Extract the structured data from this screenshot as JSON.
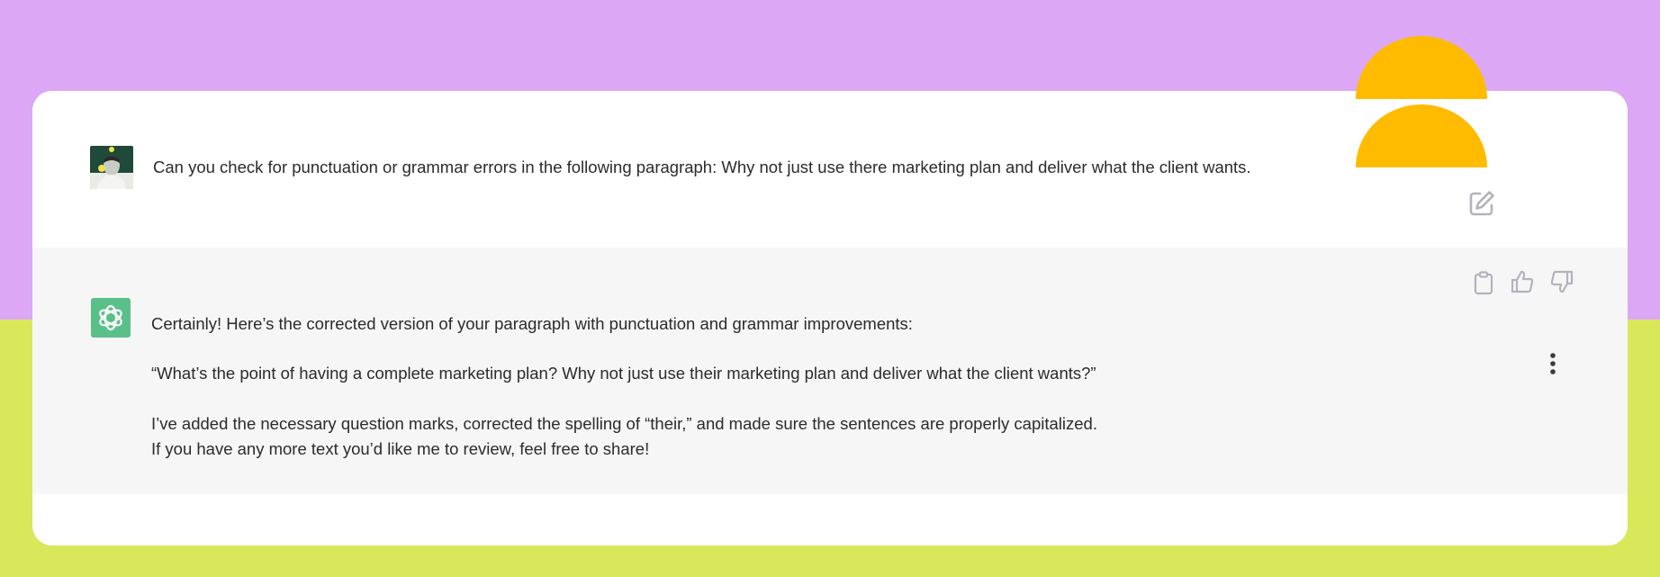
{
  "colors": {
    "background_top": "#dca8f5",
    "background_bottom": "#d9e85a",
    "card": "#ffffff",
    "assistant_row": "#f6f6f6",
    "bot_avatar": "#5ac08a",
    "accent_shape": "#ffbb00",
    "icon_gray": "#b3b3bd",
    "text": "#2b2b2b"
  },
  "user_message": {
    "avatar_icon": "user-photo-avatar",
    "text": "Can you check for punctuation or grammar errors in the following paragraph: Why not just use there marketing plan and deliver what the client wants.",
    "edit_icon": "edit-pencil-icon"
  },
  "assistant_message": {
    "avatar_icon": "openai-logo-icon",
    "paragraphs": [
      "Certainly! Here’s the corrected version of your paragraph with punctuation and grammar improvements:",
      "“What’s the point of having a complete marketing plan? Why not just use their marketing plan and deliver what the client wants?”",
      "I’ve added the necessary question marks, corrected the spelling of “their,” and made sure the sentences are properly capitalized.",
      "If you have any more text you’d like me to review, feel free to share!"
    ],
    "actions": {
      "copy_icon": "clipboard-icon",
      "thumbs_up_icon": "thumbs-up-icon",
      "thumbs_down_icon": "thumbs-down-icon",
      "more_icon": "more-vertical-icon"
    }
  },
  "decoration": {
    "icon": "stacked-half-circles-shape"
  }
}
